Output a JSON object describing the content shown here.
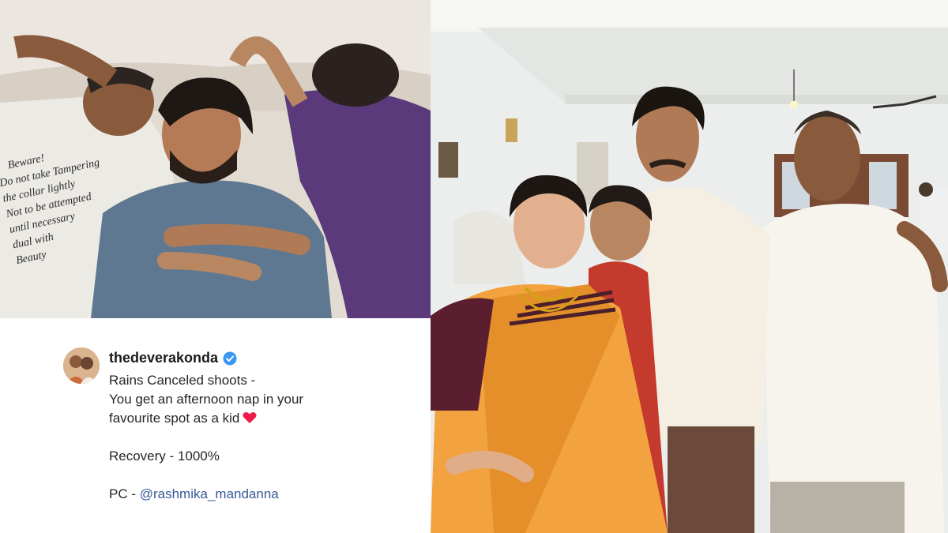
{
  "post": {
    "username": "thedeverakonda",
    "verified": true,
    "line1": "Rains Canceled shoots -",
    "line2": "You get an afternoon nap in your",
    "line3": "favourite spot as a kid",
    "heart_icon": "red-heart-icon",
    "line4": "Recovery - 1000%",
    "line5_prefix": "PC - ",
    "line5_mention": "@rashmika_mandanna",
    "mention_color": "#385898"
  },
  "photo_left": {
    "tshirt_text": [
      "Beware!",
      "Do not take Tampering",
      "the collar lightly",
      "Not to be attempted",
      "until necessary",
      "dual with",
      "Beauty"
    ]
  }
}
